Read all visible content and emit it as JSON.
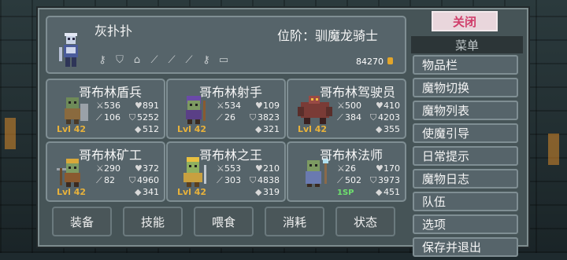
{
  "hero": {
    "name": "灰扑扑",
    "rank": "位阶：驯魔龙骑士",
    "gold": "84270"
  },
  "equipment_icons": [
    "key-icon",
    "armor-icon",
    "helmet-icon",
    "feather-icon",
    "feather-icon",
    "feather-icon",
    "key-icon",
    "item-icon"
  ],
  "monsters": [
    {
      "name": "哥布林盾兵",
      "atk": "536",
      "hp": "891",
      "mag": "106",
      "def": "5252",
      "gem": "512",
      "level": "Lvl 42"
    },
    {
      "name": "哥布林射手",
      "atk": "534",
      "hp": "109",
      "mag": "26",
      "def": "3823",
      "gem": "321",
      "level": "Lvl 42"
    },
    {
      "name": "哥布林驾驶员",
      "atk": "500",
      "hp": "410",
      "mag": "384",
      "def": "4203",
      "gem": "355",
      "level": "Lvl 42"
    },
    {
      "name": "哥布林矿工",
      "atk": "290",
      "hp": "372",
      "mag": "82",
      "def": "4960",
      "gem": "341",
      "level": "Lvl 42"
    },
    {
      "name": "哥布林之王",
      "atk": "553",
      "hp": "210",
      "mag": "303",
      "def": "4838",
      "gem": "319",
      "level": "Lvl 42"
    },
    {
      "name": "哥布林法师",
      "atk": "26",
      "hp": "170",
      "mag": "502",
      "def": "3973",
      "gem": "451",
      "level": "",
      "sp": "1SP"
    }
  ],
  "bottom_buttons": [
    "装备",
    "技能",
    "喂食",
    "消耗",
    "状态"
  ],
  "menu": {
    "close": "关闭",
    "header": "菜单",
    "items": [
      "物品栏",
      "魔物切换",
      "魔物列表",
      "使魔引导",
      "日常提示",
      "魔物日志",
      "队伍",
      "选项",
      "保存并退出"
    ]
  }
}
